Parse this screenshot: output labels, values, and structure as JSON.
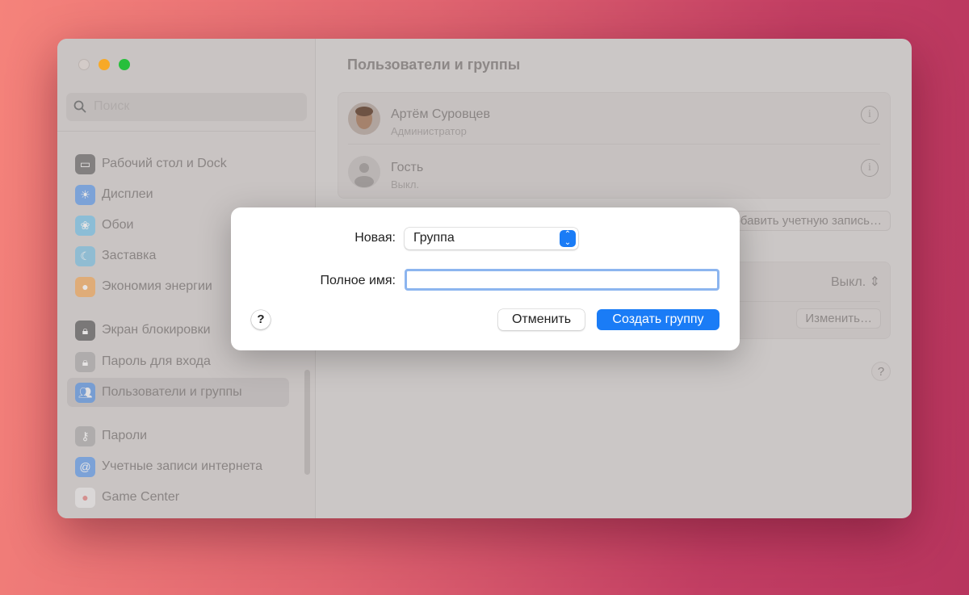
{
  "sidebar": {
    "search_placeholder": "Поиск",
    "items": [
      {
        "label": "Рабочий стол и Dock",
        "icon": "dock-icon",
        "color": "#4a4a4a"
      },
      {
        "label": "Дисплеи",
        "icon": "sun-icon",
        "color": "#3f88e8"
      },
      {
        "label": "Обои",
        "icon": "flower-icon",
        "color": "#5cb8e6"
      },
      {
        "label": "Заставка",
        "icon": "screensaver-icon",
        "color": "#62b7e0"
      },
      {
        "label": "Экономия энергии",
        "icon": "bulb-icon",
        "color": "#f29a3c"
      },
      {
        "label": "Экран блокировки",
        "icon": "lock-screen-icon",
        "color": "#3b3b3b"
      },
      {
        "label": "Пароль для входа",
        "icon": "lock-icon",
        "color": "#9a9a9a"
      },
      {
        "label": "Пользователи и группы",
        "icon": "users-icon",
        "color": "#3f88e8",
        "selected": true
      },
      {
        "label": "Пароли",
        "icon": "key-icon",
        "color": "#9a9a9a"
      },
      {
        "label": "Учетные записи интернета",
        "icon": "at-icon",
        "color": "#3f88e8"
      },
      {
        "label": "Game Center",
        "icon": "game-center-icon",
        "color": "#e8e8e8"
      }
    ]
  },
  "main": {
    "title": "Пользователи и группы",
    "users": [
      {
        "name": "Артём Суровцев",
        "role": "Администратор"
      },
      {
        "name": "Гость",
        "role": "Выкл."
      }
    ],
    "add_account_label": "Добавить учетную запись…",
    "auto_login_value": "Выкл.",
    "edit_label": "Изменить…",
    "help": "?"
  },
  "dialog": {
    "new_label": "Новая:",
    "new_value": "Группа",
    "fullname_label": "Полное имя:",
    "fullname_value": "",
    "help": "?",
    "cancel_label": "Отменить",
    "create_label": "Создать группу",
    "accent": "#1a7cf6"
  }
}
